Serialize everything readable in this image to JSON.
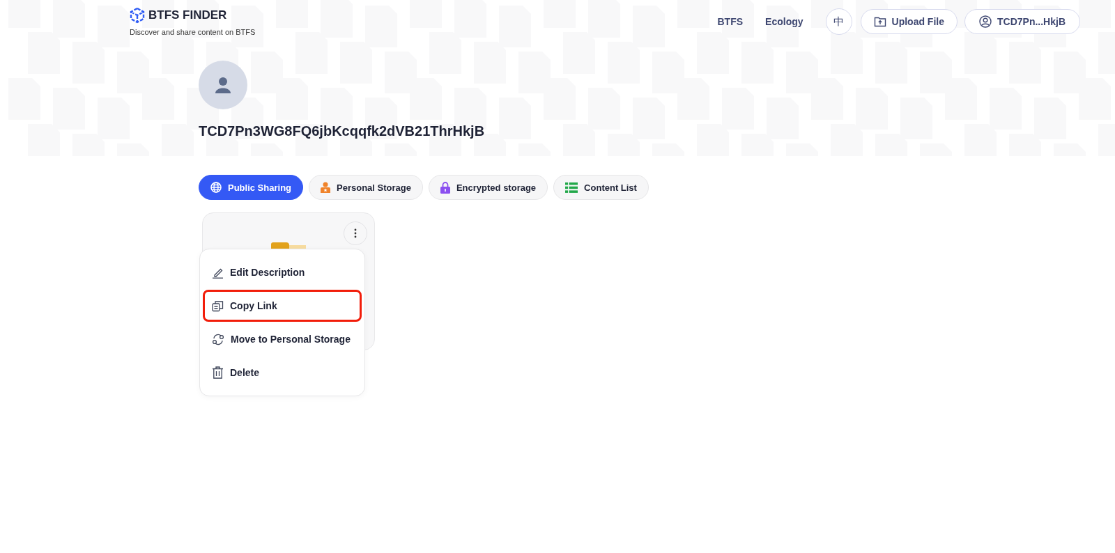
{
  "header": {
    "logo": "BTFS FINDER",
    "tagline": "Discover and share content on BTFS",
    "nav": [
      {
        "label": "BTFS"
      },
      {
        "label": "Ecology"
      }
    ],
    "language_button": "中",
    "upload_button": "Upload File",
    "account_button": "TCD7Pn...HkjB"
  },
  "profile": {
    "address": "TCD7Pn3WG8FQ6jbKcqqfk2dVB21ThrHkjB"
  },
  "tabs": [
    {
      "label": "Public Sharing",
      "kind": "globe",
      "selected": true
    },
    {
      "label": "Personal Storage",
      "kind": "person",
      "selected": false
    },
    {
      "label": "Encrypted storage",
      "kind": "lock",
      "selected": false
    },
    {
      "label": "Content List",
      "kind": "list",
      "selected": false
    }
  ],
  "context_menu": {
    "items": [
      {
        "label": "Edit Description",
        "kind": "edit",
        "highlighted": false
      },
      {
        "label": "Copy Link",
        "kind": "copy",
        "highlighted": true
      },
      {
        "label": "Move to Personal Storage",
        "kind": "move",
        "highlighted": false
      },
      {
        "label": "Delete",
        "kind": "delete",
        "highlighted": false
      }
    ]
  }
}
